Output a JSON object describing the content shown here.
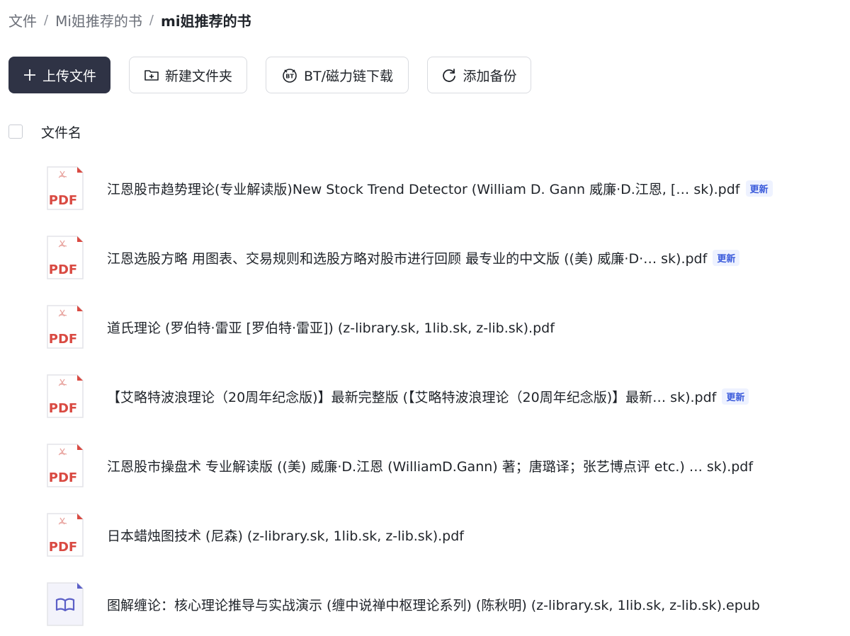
{
  "breadcrumb": {
    "items": [
      "文件",
      "Mi姐推荐的书",
      "mi姐推荐的书"
    ],
    "separator": "/"
  },
  "toolbar": {
    "upload_label": "上传文件",
    "new_folder_label": "新建文件夹",
    "bt_label": "BT/磁力链下载",
    "backup_label": "添加备份"
  },
  "table": {
    "column_name": "文件名"
  },
  "badge_label": "更新",
  "files": [
    {
      "type": "pdf",
      "name": "江恩股市趋势理论(专业解读版)New Stock Trend Detector (William D. Gann 威廉·D.江恩, [… sk).pdf",
      "badge": "更新"
    },
    {
      "type": "pdf",
      "name": "江恩选股方略 用图表、交易规则和选股方略对股市进行回顾 最专业的中文版 ((美) 威廉·D·… sk).pdf",
      "badge": "更新"
    },
    {
      "type": "pdf",
      "name": "道氏理论 (罗伯特·雷亚 [罗伯特·雷亚]) (z-library.sk, 1lib.sk, z-lib.sk).pdf",
      "badge": ""
    },
    {
      "type": "pdf",
      "name": "【艾略特波浪理论（20周年纪念版)】最新完整版 (【艾略特波浪理论（20周年纪念版)】最新… sk).pdf",
      "badge": "更新"
    },
    {
      "type": "pdf",
      "name": "江恩股市操盘术 专业解读版 ((美) 威廉·D.江恩 (WilliamD.Gann) 著；唐璐译；张艺博点评 etc.) … sk).pdf",
      "badge": ""
    },
    {
      "type": "pdf",
      "name": "日本蜡烛图技术 (尼森) (z-library.sk, 1lib.sk, z-lib.sk).pdf",
      "badge": ""
    },
    {
      "type": "epub",
      "name": "图解缠论：核心理论推导与实战演示 (缠中说禅中枢理论系列) (陈秋明) (z-library.sk, 1lib.sk, z-lib.sk).epub",
      "badge": ""
    }
  ],
  "icons": {
    "upload": "plus-icon",
    "new_folder": "folder-plus-icon",
    "bt": "bt-icon",
    "backup": "sync-icon",
    "pdf_file": "pdf-file-icon",
    "epub_file": "epub-book-icon"
  },
  "colors": {
    "primary_button": "#2f3345",
    "pdf_red": "#d94a42",
    "epub_purple": "#5b5fc7",
    "badge_blue": "#3b5bdb"
  },
  "pdf_icon_text": "PDF"
}
